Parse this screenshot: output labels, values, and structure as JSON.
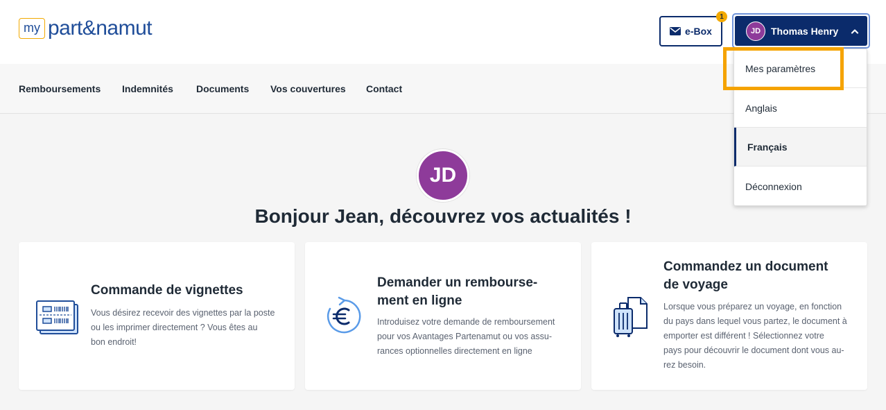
{
  "header": {
    "logo_my": "my",
    "logo_text": "part&namut",
    "ebox_label": "e-Box",
    "ebox_badge": "1",
    "user": {
      "initials": "JD",
      "name": "Thomas Henry"
    }
  },
  "nav": {
    "items": [
      "Remboursements",
      "Indemnités",
      "Documents",
      "Vos couvertures",
      "Contact"
    ]
  },
  "dropdown": {
    "items": [
      "Mes paramètres",
      "Anglais",
      "Français",
      "Déconnexion"
    ],
    "active_index": 2
  },
  "main": {
    "avatar_initials": "JD",
    "greeting": "Bonjour Jean, découvrez vos actualités !"
  },
  "cards": [
    {
      "icon": "stickers-icon",
      "title": "Commande de vignettes",
      "desc_lines": [
        "Vous désirez recevoir des vignettes par la poste",
        "ou les imprimer directement ? Vous êtes au",
        "bon endroit!"
      ]
    },
    {
      "icon": "euro-refresh-icon",
      "title_lines": [
        "Demander un rembourse-",
        "ment en ligne"
      ],
      "desc_lines": [
        "Introduisez votre demande de remboursement",
        "pour vos Avantages Partenamut ou vos assu-",
        "rances optionnelles directement en ligne"
      ]
    },
    {
      "icon": "luggage-document-icon",
      "title_lines": [
        "Commandez un document",
        "de voyage"
      ],
      "desc_lines": [
        "Lorsque vous préparez un voyage, en fonction",
        "du pays dans lequel vous partez, le document à",
        "emporter est différent ! Sélectionnez votre",
        "pays pour découvrir le document dont vous au-",
        "rez besoin."
      ]
    }
  ],
  "colors": {
    "navy": "#0b2b6b",
    "purple": "#8e3b9a",
    "accent_orange": "#f5a300",
    "brand_blue": "#1f4d99"
  }
}
